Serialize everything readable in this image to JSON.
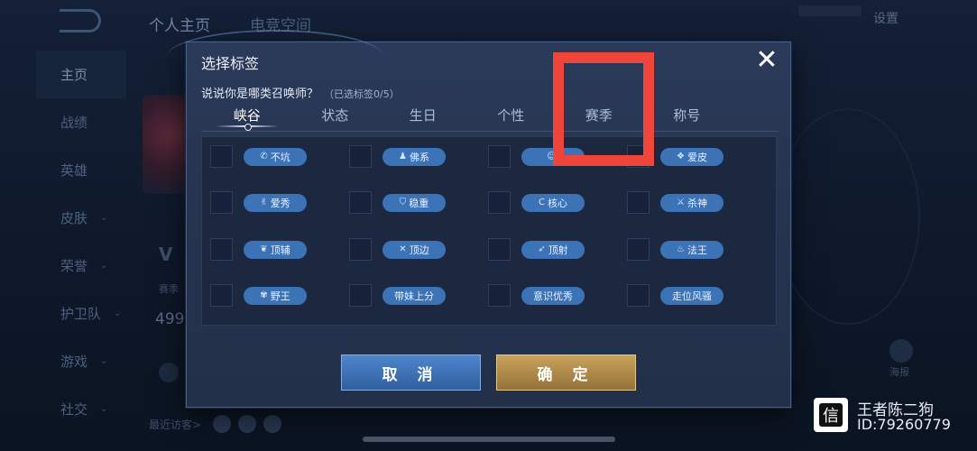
{
  "background": {
    "tabs": [
      "个人主页",
      "电竞空间"
    ],
    "settings_label": "设置",
    "sidebar": [
      {
        "label": "主页",
        "active": true,
        "chevron": false
      },
      {
        "label": "战绩",
        "active": false,
        "chevron": false
      },
      {
        "label": "英雄",
        "active": false,
        "chevron": false
      },
      {
        "label": "皮肤",
        "active": false,
        "chevron": true
      },
      {
        "label": "荣誉",
        "active": false,
        "chevron": true
      },
      {
        "label": "护卫队",
        "active": false,
        "chevron": true
      },
      {
        "label": "游戏",
        "active": false,
        "chevron": true
      },
      {
        "label": "社交",
        "active": false,
        "chevron": true
      }
    ],
    "chevron_glyph": "⌄",
    "stat_value": "499",
    "season_label": "赛季",
    "recent_visitors_label": "最近访客>",
    "poster_label": "海报"
  },
  "dialog": {
    "title": "选择标签",
    "close_glyph": "✕",
    "subtitle": "说说你是哪类召唤师？",
    "selected_count": "（已选标签0/5）",
    "tabs": [
      {
        "label": "峡谷",
        "active": true
      },
      {
        "label": "状态",
        "active": false
      },
      {
        "label": "生日",
        "active": false
      },
      {
        "label": "个性",
        "active": false
      },
      {
        "label": "赛季",
        "active": false
      },
      {
        "label": "称号",
        "active": false
      }
    ],
    "tags": [
      [
        {
          "label": "不坑",
          "icon": "phone-icon",
          "glyph": "✆"
        },
        {
          "label": "佛系",
          "icon": "person-icon",
          "glyph": "♟"
        },
        {
          "label": "",
          "icon": "face-icon",
          "glyph": "☺"
        },
        {
          "label": "爱皮",
          "icon": "mask-icon",
          "glyph": "❖"
        }
      ],
      [
        {
          "label": "爱秀",
          "icon": "victory-hand-icon",
          "glyph": "✌"
        },
        {
          "label": "稳重",
          "icon": "shield-icon",
          "glyph": "⛉"
        },
        {
          "label": "核心",
          "icon": "c-letter-icon",
          "glyph": "C"
        },
        {
          "label": "杀神",
          "icon": "sword-icon",
          "glyph": "⚔"
        }
      ],
      [
        {
          "label": "顶辅",
          "icon": "support-icon",
          "glyph": "❦"
        },
        {
          "label": "顶边",
          "icon": "crossed-swords-icon",
          "glyph": "✕"
        },
        {
          "label": "顶射",
          "icon": "bow-icon",
          "glyph": "➶"
        },
        {
          "label": "法王",
          "icon": "flame-icon",
          "glyph": "♨"
        }
      ],
      [
        {
          "label": "野王",
          "icon": "claw-icon",
          "glyph": "✾"
        },
        {
          "label": "带妹上分",
          "icon": "",
          "glyph": ""
        },
        {
          "label": "意识优秀",
          "icon": "",
          "glyph": ""
        },
        {
          "label": "走位风骚",
          "icon": "",
          "glyph": ""
        }
      ]
    ],
    "cancel_label": "取 消",
    "confirm_label": "确 定"
  },
  "watermark": {
    "logo_text": "信",
    "name": "王者陈二狗",
    "id": "ID:79260779"
  },
  "colors": {
    "highlight": "#f0453a",
    "pill": "#3c73b6",
    "cancel": "#2f5f9f",
    "confirm": "#94723a"
  }
}
